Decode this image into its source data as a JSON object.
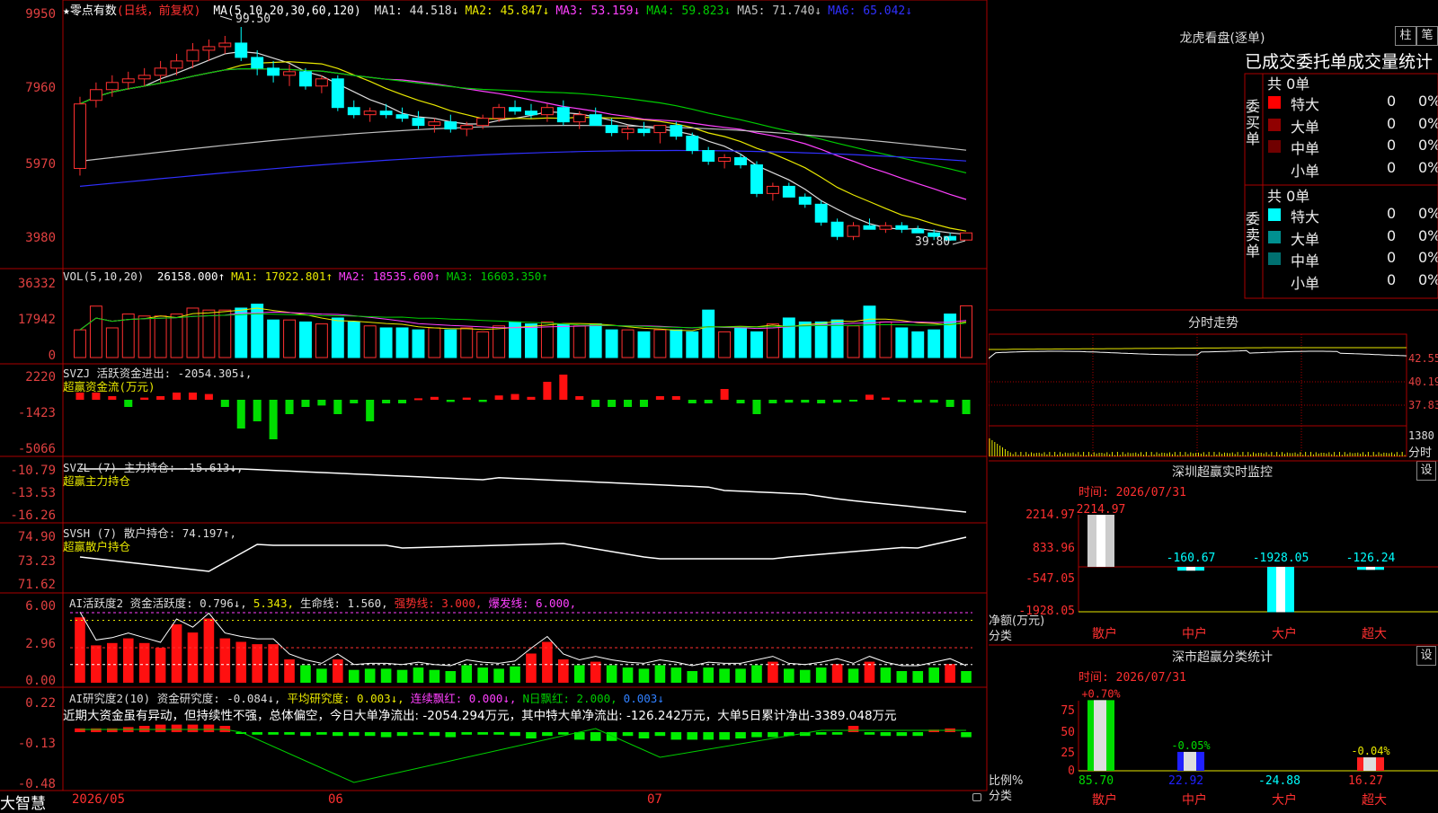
{
  "stock": {
    "name": "★零点有数",
    "mode": "(日线，前复权)"
  },
  "main": {
    "ma_header": "MA(5,10,20,30,60,120)",
    "ma_items": [
      {
        "label": "MA1: 44.518↓",
        "color": "#dddddd"
      },
      {
        "label": "MA2: 45.847↓",
        "color": "#e8e800"
      },
      {
        "label": "MA3: 53.159↓",
        "color": "#ff40ff"
      },
      {
        "label": "MA4: 59.823↓",
        "color": "#00cc00"
      },
      {
        "label": "MA5: 71.740↓",
        "color": "#c0c0c0"
      },
      {
        "label": "MA6: 65.042↓",
        "color": "#3030ff"
      }
    ],
    "yticks": [
      "9950",
      "7960",
      "5970",
      "3980"
    ],
    "high_label": "99.50",
    "low_label": "39.80"
  },
  "vol": {
    "header": "VOL(5,10,20)",
    "items": [
      {
        "label": "26158.000↑",
        "color": "#ffffff"
      },
      {
        "label": "MA1: 17022.801↑",
        "color": "#e8e800"
      },
      {
        "label": "MA2: 18535.600↑",
        "color": "#ff40ff"
      },
      {
        "label": "MA3: 16603.350↑",
        "color": "#00cc00"
      }
    ],
    "yticks": [
      "36332",
      "17942",
      "0"
    ]
  },
  "svzj": {
    "header": "SVZJ  活跃资金进出: -2054.305↓,",
    "sub": "超赢资金流(万元)",
    "yticks": [
      "2220",
      "-1423",
      "-5066"
    ]
  },
  "svzl": {
    "header": "SVZL (7) 主力持仓: -15.613↓,",
    "sub": "超赢主力持仓",
    "yticks": [
      "-10.79",
      "-13.53",
      "-16.26"
    ]
  },
  "svsh": {
    "header": "SVSH (7) 散户持仓: 74.197↑,",
    "sub": "超赢散户持仓",
    "yticks": [
      "74.90",
      "73.23",
      "71.62"
    ]
  },
  "ai1": {
    "items": [
      {
        "label": "AI活跃度2 资金活跃度: 0.796↓,",
        "color": "#dddddd"
      },
      {
        "label": "5.343,",
        "color": "#e8e800"
      },
      {
        "label": "生命线: 1.560,",
        "color": "#dddddd"
      },
      {
        "label": "强势线: 3.000,",
        "color": "#ff3030"
      },
      {
        "label": "爆发线: 6.000,",
        "color": "#ff40ff"
      }
    ],
    "yticks": [
      "6.00",
      "2.96",
      "0.00"
    ]
  },
  "ai2": {
    "items": [
      {
        "label": "AI研究度2(10) 资金研究度: -0.084↓,",
        "color": "#dddddd"
      },
      {
        "label": "平均研究度: 0.003↓,",
        "color": "#e8e800"
      },
      {
        "label": "连续飘红: 0.000↓,",
        "color": "#ff40ff"
      },
      {
        "label": "N日飘红: 2.000,",
        "color": "#00cc00"
      },
      {
        "label": "0.003↓",
        "color": "#3080ff"
      }
    ],
    "comment": "近期大资金虽有异动，但持续性不强，总体偏空，今日大单净流出: -2054.294万元，其中特大单净流出: -126.242万元，大单5日累计净出-3389.048万元",
    "yticks": [
      "0.22",
      "-0.13",
      "-0.48"
    ]
  },
  "xaxis": {
    "brand": "大智慧",
    "labels": [
      "2026/05",
      "06",
      "07"
    ]
  },
  "lhb": {
    "title": "龙虎看盘(逐单)",
    "btn1": "柱",
    "btn2": "笔",
    "subtitle": "已成交委托单成交量统计",
    "buy_label": "委买单",
    "sell_label": "委卖单",
    "buy_total": "共 0单",
    "sell_total": "共 0单",
    "buy_rows": [
      {
        "name": "特大",
        "val": "0",
        "pct": "0%",
        "color": "#ff0000"
      },
      {
        "name": "大单",
        "val": "0",
        "pct": "0%",
        "color": "#900000"
      },
      {
        "name": "中单",
        "val": "0",
        "pct": "0%",
        "color": "#700000"
      },
      {
        "name": "小单",
        "val": "0",
        "pct": "0%",
        "color": "#000000"
      }
    ],
    "sell_rows": [
      {
        "name": "特大",
        "val": "0",
        "pct": "0%",
        "color": "#00ffff"
      },
      {
        "name": "大单",
        "val": "0",
        "pct": "0%",
        "color": "#009090"
      },
      {
        "name": "中单",
        "val": "0",
        "pct": "0%",
        "color": "#007070"
      },
      {
        "name": "小单",
        "val": "0",
        "pct": "0%",
        "color": "#000000"
      }
    ]
  },
  "intraday": {
    "title": "分时走势",
    "yticks": [
      "42.55",
      "40.19",
      "37.83"
    ],
    "vol_tick": "1380",
    "vol_label": "分时"
  },
  "sz_monitor": {
    "title": "深圳超赢实时监控",
    "set": "设",
    "time": "时间: 2026/07/31",
    "yticks": [
      "2214.97",
      "833.96",
      "-547.05",
      "-1928.05"
    ],
    "ylabel1": "净额(万元)",
    "ylabel2": "分类",
    "bars": [
      {
        "cat": "散户",
        "val": 2214.97,
        "label": "2214.97"
      },
      {
        "cat": "中户",
        "val": -160.67,
        "label": "-160.67"
      },
      {
        "cat": "大户",
        "val": -1928.05,
        "label": "-1928.05"
      },
      {
        "cat": "超大",
        "val": -126.24,
        "label": "-126.24"
      }
    ]
  },
  "sz_class": {
    "title": "深市超赢分类统计",
    "set": "设",
    "time": "时间: 2026/07/31",
    "yticks": [
      "75",
      "50",
      "25",
      "0"
    ],
    "ylabel1": "比例%",
    "ylabel2": "分类",
    "bars": [
      {
        "cat": "散户",
        "pct": "+0.70%",
        "val": 85.7,
        "label": "85.70",
        "color": "#00dd00"
      },
      {
        "cat": "中户",
        "pct": "-0.05%",
        "val": 22.92,
        "label": "22.92",
        "color": "#2020ff"
      },
      {
        "cat": "大户",
        "pct": "",
        "val": 0,
        "label": "-24.88",
        "color": "#00dd00"
      },
      {
        "cat": "超大",
        "pct": "-0.04%",
        "val": 16.27,
        "label": "16.27",
        "color": "#ff2020"
      }
    ]
  },
  "chart_data": {
    "type": "candlestick",
    "dates_span": [
      "2026/05",
      "2026/06",
      "2026/07"
    ],
    "ohlc": [
      [
        60,
        80,
        58,
        78
      ],
      [
        79,
        84,
        77,
        82
      ],
      [
        82,
        86,
        80,
        84
      ],
      [
        84,
        87,
        82,
        85
      ],
      [
        85,
        88,
        83,
        86
      ],
      [
        86,
        90,
        84,
        88
      ],
      [
        88,
        92,
        86,
        90
      ],
      [
        90,
        95,
        88,
        93
      ],
      [
        93,
        96,
        90,
        94
      ],
      [
        94,
        97,
        92,
        95
      ],
      [
        95,
        99.5,
        90,
        91
      ],
      [
        91,
        93,
        86,
        88
      ],
      [
        88,
        90,
        84,
        86
      ],
      [
        86,
        89,
        83,
        87
      ],
      [
        87,
        88,
        82,
        83
      ],
      [
        83,
        86,
        81,
        85
      ],
      [
        85,
        86,
        76,
        77
      ],
      [
        77,
        79,
        74,
        75
      ],
      [
        75,
        77,
        73,
        76
      ],
      [
        76,
        78,
        74,
        75
      ],
      [
        75,
        77,
        73,
        74
      ],
      [
        74,
        76,
        71,
        72
      ],
      [
        72,
        74,
        70,
        73
      ],
      [
        73,
        75,
        70,
        71
      ],
      [
        71,
        73,
        69,
        72
      ],
      [
        72,
        75,
        71,
        74
      ],
      [
        74,
        78,
        73,
        77
      ],
      [
        77,
        79,
        75,
        76
      ],
      [
        76,
        78,
        74,
        75
      ],
      [
        75,
        78,
        73,
        77
      ],
      [
        77,
        79,
        72,
        73
      ],
      [
        73,
        76,
        71,
        75
      ],
      [
        75,
        77,
        72,
        72
      ],
      [
        72,
        74,
        69,
        70
      ],
      [
        70,
        72,
        68,
        71
      ],
      [
        71,
        73,
        69,
        70
      ],
      [
        70,
        72,
        67,
        72
      ],
      [
        72,
        73,
        68,
        69
      ],
      [
        69,
        70,
        64,
        65
      ],
      [
        65,
        66,
        61,
        62
      ],
      [
        62,
        64,
        60,
        63
      ],
      [
        63,
        64,
        60,
        61
      ],
      [
        61,
        62,
        52,
        53
      ],
      [
        53,
        56,
        51,
        55
      ],
      [
        55,
        56,
        52,
        52
      ],
      [
        52,
        53,
        49,
        50
      ],
      [
        50,
        51,
        44,
        45
      ],
      [
        45,
        46,
        40,
        41
      ],
      [
        41,
        45,
        40,
        44
      ],
      [
        44,
        46,
        43,
        43
      ],
      [
        43,
        45,
        42,
        44
      ],
      [
        44,
        45,
        42,
        43
      ],
      [
        43,
        44,
        42,
        42
      ],
      [
        42,
        43,
        40,
        41
      ],
      [
        41,
        42,
        39.8,
        40
      ],
      [
        40,
        42,
        40,
        42
      ]
    ],
    "volume": [
      14000,
      26000,
      15000,
      22000,
      21000,
      21000,
      22000,
      25000,
      24000,
      24000,
      25000,
      27000,
      19000,
      19000,
      18000,
      17000,
      20000,
      18000,
      16000,
      15000,
      15000,
      14000,
      15000,
      14000,
      15000,
      13000,
      16000,
      18000,
      17000,
      18000,
      17000,
      16000,
      17000,
      14000,
      14000,
      13000,
      14000,
      14000,
      13000,
      24000,
      13000,
      15000,
      13000,
      17000,
      20000,
      18000,
      18000,
      19000,
      16000,
      26000,
      18000,
      15000,
      13000,
      14000,
      22000,
      26158
    ],
    "ma_series_names": [
      "MA1",
      "MA2",
      "MA3",
      "MA4",
      "MA5",
      "MA6"
    ]
  }
}
